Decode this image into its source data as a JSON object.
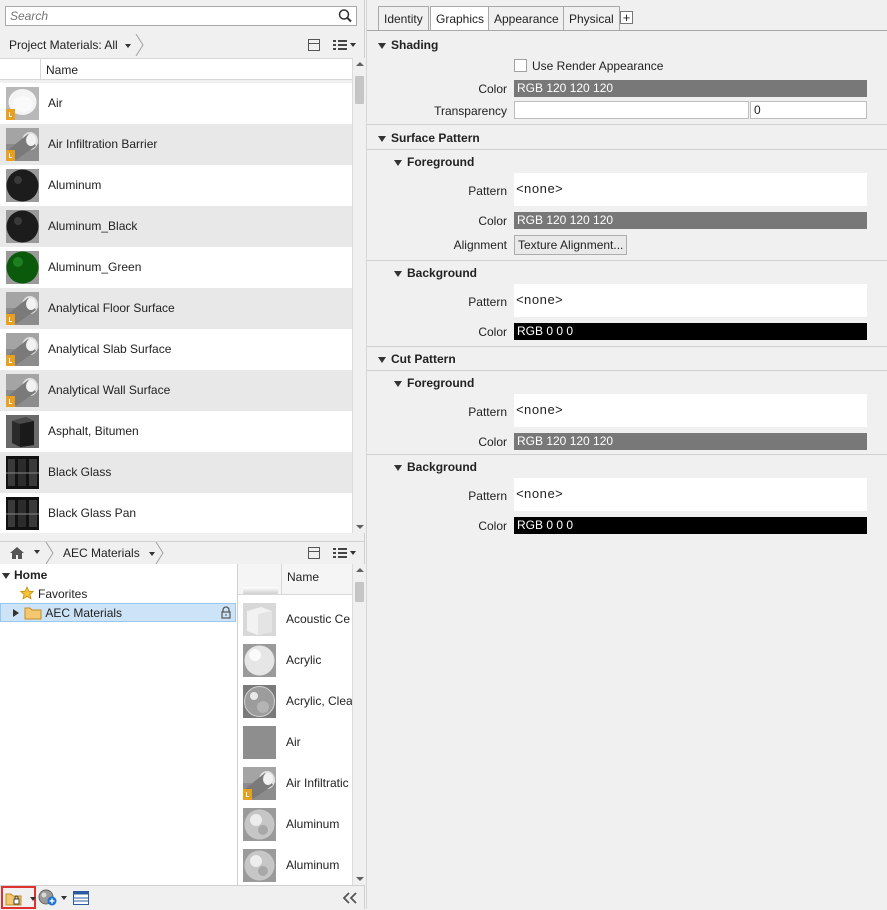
{
  "left_panel": {
    "search": {
      "placeholder": "Search"
    },
    "project_materials": {
      "breadcrumb": "Project Materials: All",
      "column_header": "Name",
      "items": [
        {
          "label": "Air",
          "thumb": "air"
        },
        {
          "label": "Air Infiltration Barrier",
          "thumb": "cylinder"
        },
        {
          "label": "Aluminum",
          "thumb": "dark-sphere"
        },
        {
          "label": "Aluminum_Black",
          "thumb": "dark-sphere"
        },
        {
          "label": "Aluminum_Green",
          "thumb": "green-sphere"
        },
        {
          "label": "Analytical Floor Surface",
          "thumb": "cylinder"
        },
        {
          "label": "Analytical Slab Surface",
          "thumb": "cylinder"
        },
        {
          "label": "Analytical Wall Surface",
          "thumb": "cylinder"
        },
        {
          "label": "Asphalt, Bitumen",
          "thumb": "dark-cube"
        },
        {
          "label": "Black Glass",
          "thumb": "glass-panel"
        },
        {
          "label": "Black Glass Pan",
          "thumb": "glass-panel"
        }
      ]
    },
    "library": {
      "home_label": "Home",
      "breadcrumb": "AEC Materials",
      "tree": [
        {
          "label": "Home"
        },
        {
          "label": "Favorites"
        },
        {
          "label": "AEC Materials"
        }
      ],
      "column_header": "Name",
      "items": [
        {
          "label": "Acoustic Ce",
          "thumb": "white-cube"
        },
        {
          "label": "Acrylic",
          "thumb": "white-sphere"
        },
        {
          "label": "Acrylic, Clea",
          "thumb": "clear-sphere"
        },
        {
          "label": "Air",
          "thumb": "gray-flat"
        },
        {
          "label": "Air Infiltratic",
          "thumb": "cylinder"
        },
        {
          "label": "Aluminum",
          "thumb": "metal-sphere"
        },
        {
          "label": "Aluminum",
          "thumb": "metal-sphere"
        }
      ]
    },
    "bottom_toolbar": {
      "icons": [
        "folder-lock-icon",
        "add-material-icon",
        "panel-toggle-icon",
        "collapse-left-icon"
      ]
    }
  },
  "right_panel": {
    "tabs": [
      "Identity",
      "Graphics",
      "Appearance",
      "Physical"
    ],
    "active_tab": "Graphics",
    "shading": {
      "title": "Shading",
      "use_render_label": "Use Render Appearance",
      "color_label": "Color",
      "color_value": "RGB 120 120 120",
      "transparency_label": "Transparency",
      "transparency_value": "0"
    },
    "surface_pattern": {
      "title": "Surface Pattern",
      "foreground": {
        "title": "Foreground",
        "pattern_label": "Pattern",
        "pattern_value": "<none>",
        "color_label": "Color",
        "color_value": "RGB 120 120 120",
        "alignment_label": "Alignment",
        "alignment_button": "Texture Alignment..."
      },
      "background": {
        "title": "Background",
        "pattern_label": "Pattern",
        "pattern_value": "<none>",
        "color_label": "Color",
        "color_value": "RGB 0 0 0"
      }
    },
    "cut_pattern": {
      "title": "Cut Pattern",
      "foreground": {
        "title": "Foreground",
        "pattern_label": "Pattern",
        "pattern_value": "<none>",
        "color_label": "Color",
        "color_value": "RGB 120 120 120"
      },
      "background": {
        "title": "Background",
        "pattern_label": "Pattern",
        "pattern_value": "<none>",
        "color_label": "Color",
        "color_value": "RGB 0 0 0"
      }
    }
  },
  "colors": {
    "gray_swatch": "#787878",
    "black_swatch": "#000000",
    "selection": "#cde3f7",
    "highlight_border": "#e03030"
  }
}
